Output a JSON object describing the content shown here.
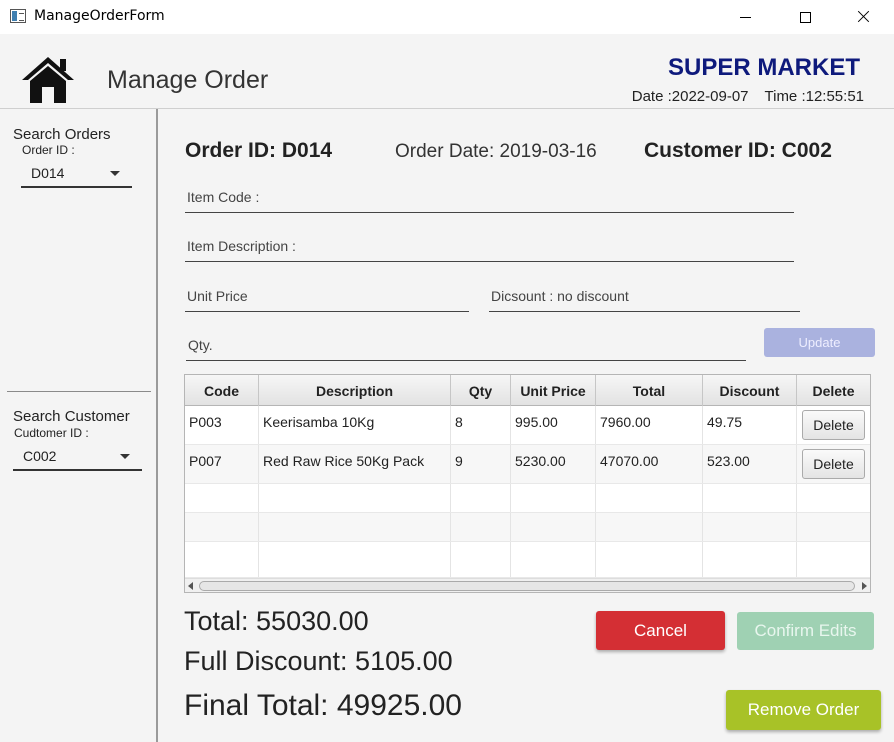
{
  "window": {
    "title": "ManageOrderForm"
  },
  "header": {
    "page_title": "Manage Order",
    "brand": "SUPER MARKET",
    "date": "Date :2022-09-07",
    "time": "Time :12:55:51"
  },
  "sidebar": {
    "search_orders_label": "Search Orders",
    "order_id_label": "Order ID :",
    "order_id_value": "D014",
    "search_customer_label": "Search Customer",
    "customer_id_label": "Cudtomer ID :",
    "customer_id_value": "C002"
  },
  "order": {
    "order_id": "Order ID: D014",
    "order_date": "Order Date: 2019-03-16",
    "customer_id": "Customer ID: C002"
  },
  "form": {
    "item_code": "Item Code :",
    "item_description": "Item Description :",
    "unit_price": "Unit Price",
    "discount": "Dicsount : no discount",
    "qty": "Qty.",
    "update_label": "Update"
  },
  "table": {
    "headers": [
      "Code",
      "Description",
      "Qty",
      "Unit Price",
      "Total",
      "Discount",
      "Delete"
    ],
    "rows": [
      {
        "code": "P003",
        "description": "Keerisamba 10Kg",
        "qty": "8",
        "unit_price": "995.00",
        "total": "7960.00",
        "discount": "49.75",
        "delete_label": "Delete"
      },
      {
        "code": "P007",
        "description": "Red Raw Rice 50Kg Pack",
        "qty": "9",
        "unit_price": "5230.00",
        "total": "47070.00",
        "discount": "523.00",
        "delete_label": "Delete"
      }
    ]
  },
  "totals": {
    "total": "Total: 55030.00",
    "full_discount": "Full Discount: 5105.00",
    "final_total": "Final Total: 49925.00"
  },
  "actions": {
    "cancel_label": "Cancel",
    "confirm_label": "Confirm Edits",
    "remove_label": "Remove Order"
  },
  "colors": {
    "brand": "#0e1a7c",
    "cancel": "#d42f34",
    "confirm_disabled": "#9fd1b3",
    "remove": "#a8c227",
    "update_disabled": "#aab2df"
  }
}
